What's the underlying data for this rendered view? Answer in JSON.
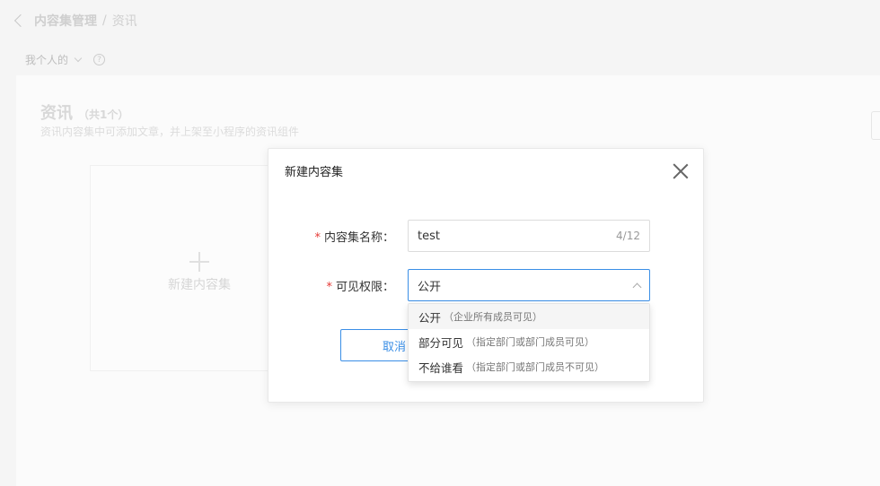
{
  "breadcrumb": {
    "parent": "内容集管理",
    "separator": "/",
    "current": "资讯"
  },
  "filter": {
    "label": "我个人的",
    "help": "?"
  },
  "section": {
    "title": "资讯",
    "count": "（共1个）",
    "description": "资讯内容集中可添加文章，并上架至小程序的资讯组件"
  },
  "new_tile": {
    "label": "新建内容集"
  },
  "modal": {
    "title": "新建内容集",
    "name_label": "内容集名称：",
    "name_value": "test",
    "name_count": "4/12",
    "perm_label": "可见权限：",
    "perm_value": "公开",
    "required_mark": "*",
    "cancel_label": "取消"
  },
  "dropdown": {
    "options": [
      {
        "label": "公开",
        "hint": "（企业所有成员可见）"
      },
      {
        "label": "部分可见",
        "hint": "（指定部门或部门成员可见）"
      },
      {
        "label": "不给谁看",
        "hint": "（指定部门或部门成员不可见）"
      }
    ]
  },
  "colors": {
    "accent": "#3a8ee6",
    "required": "#e53935"
  }
}
